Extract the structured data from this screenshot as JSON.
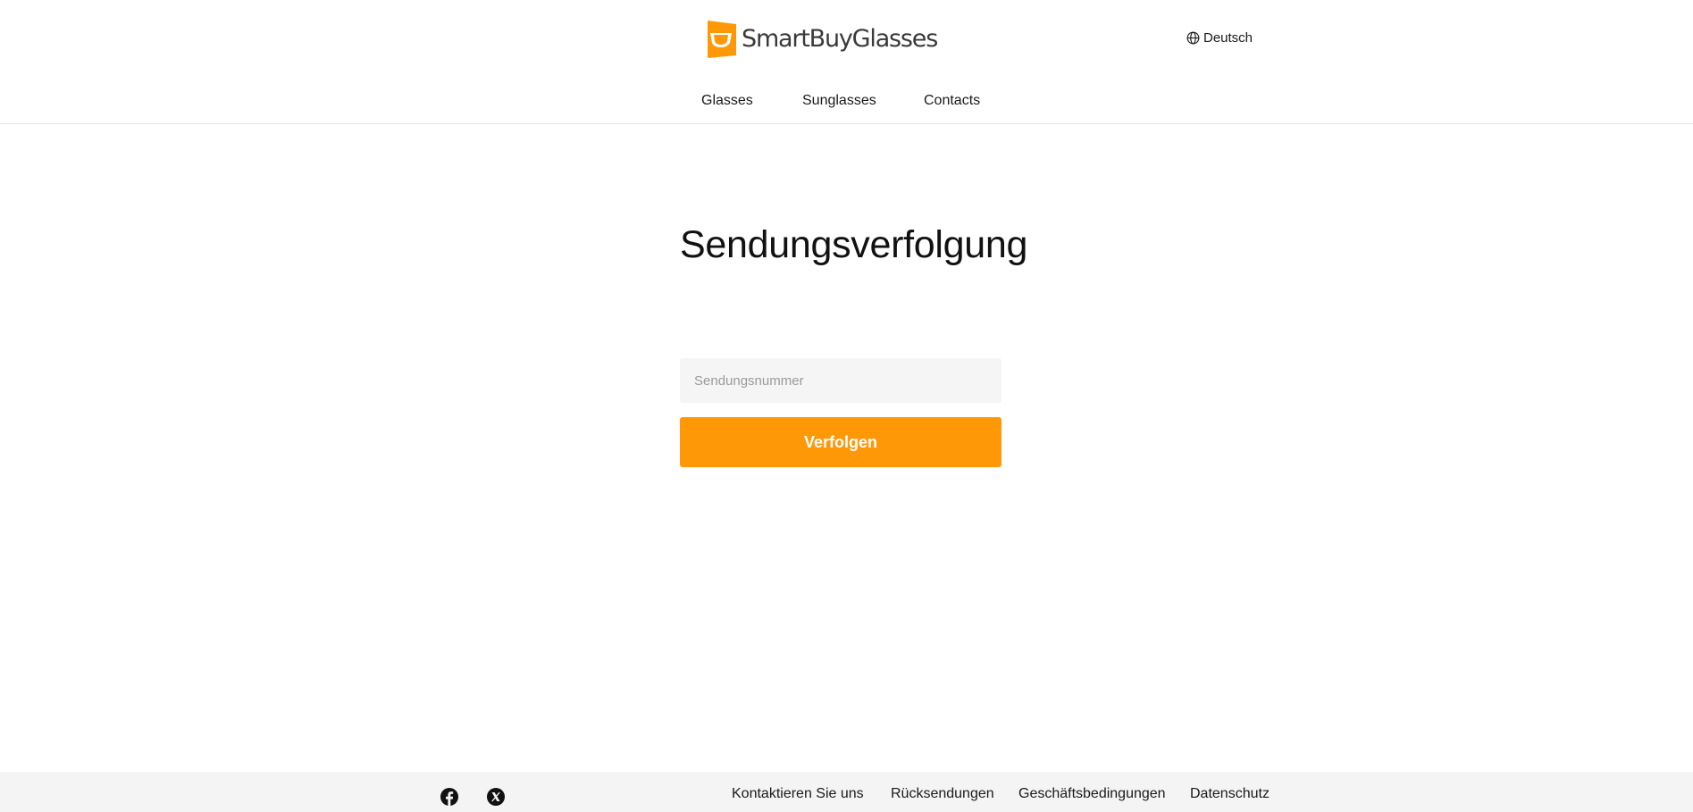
{
  "header": {
    "logo_text": "SmartBuyGlasses",
    "language": "Deutsch"
  },
  "nav": {
    "items": [
      "Glasses",
      "Sunglasses",
      "Contacts"
    ]
  },
  "main": {
    "title": "Sendungsverfolgung",
    "tracking_placeholder": "Sendungsnummer",
    "tracking_value": "",
    "track_button": "Verfolgen"
  },
  "footer": {
    "social_icons": [
      "facebook-icon",
      "x-twitter-icon"
    ],
    "links": [
      "Kontaktieren Sie uns",
      "Rücksendungen",
      "Geschäftsbedingungen",
      "Datenschutz"
    ]
  },
  "colors": {
    "brand_orange": "#ff9806",
    "input_background": "#f5f5f5",
    "footer_background": "#f4f4f4"
  }
}
